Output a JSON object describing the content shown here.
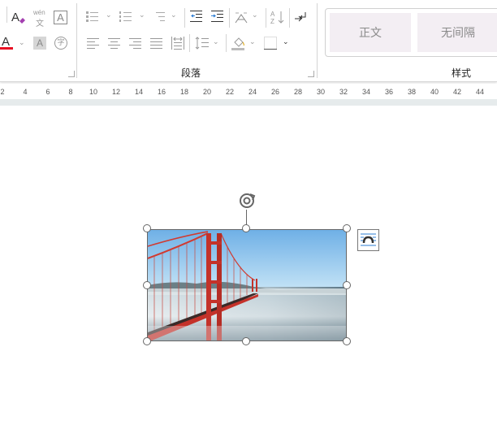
{
  "ribbon": {
    "font_group": {
      "icons": [
        "clear-formatting-icon",
        "phonetic-guide-icon",
        "character-border-icon",
        "font-color-icon",
        "character-shading-icon",
        "enclose-characters-icon"
      ],
      "phonetic_text": "wén",
      "phonetic_char": "文",
      "font_color": "#e81123",
      "enclose_char": "字"
    },
    "paragraph_group": {
      "label": "段落",
      "icons": [
        "bullets-icon",
        "numbering-icon",
        "multilevel-list-icon",
        "decrease-indent-icon",
        "increase-indent-icon",
        "chinese-layout-icon",
        "sort-icon",
        "show-marks-icon",
        "align-left-icon",
        "center-icon",
        "align-right-icon",
        "justify-icon",
        "distributed-icon",
        "line-spacing-icon",
        "shading-icon",
        "borders-icon"
      ]
    },
    "styles_group": {
      "label": "样式",
      "items": [
        "正文",
        "无间隔"
      ]
    }
  },
  "ruler": {
    "ticks": [
      "2",
      "4",
      "6",
      "8",
      "10",
      "12",
      "14",
      "16",
      "18",
      "20",
      "22",
      "24",
      "26",
      "28",
      "30",
      "32",
      "34",
      "36",
      "38",
      "40",
      "42",
      "44"
    ]
  },
  "document": {
    "image": {
      "selected": true,
      "description_icon": "layout-options-icon"
    }
  }
}
